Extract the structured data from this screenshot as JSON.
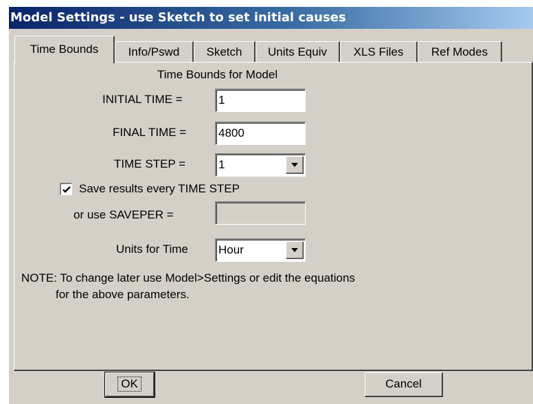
{
  "window": {
    "title": "Model Settings - use Sketch to set initial causes"
  },
  "tabs": [
    {
      "label": "Time Bounds",
      "active": true
    },
    {
      "label": "Info/Pswd",
      "active": false
    },
    {
      "label": "Sketch",
      "active": false
    },
    {
      "label": "Units Equiv",
      "active": false
    },
    {
      "label": "XLS Files",
      "active": false
    },
    {
      "label": "Ref Modes",
      "active": false
    }
  ],
  "time_bounds": {
    "heading": "Time Bounds for Model",
    "initial_time_label": "INITIAL TIME =",
    "initial_time_value": "1",
    "final_time_label": "FINAL TIME =",
    "final_time_value": "4800",
    "time_step_label": "TIME STEP =",
    "time_step_value": "1",
    "save_results_label": "Save results every TIME STEP",
    "save_results_checked": true,
    "saveper_label": "or use SAVEPER =",
    "saveper_value": "",
    "units_label": "Units for Time",
    "units_value": "Hour",
    "note_line1": "NOTE:  To change later use Model>Settings or edit the equations",
    "note_line2": "for the above parameters."
  },
  "buttons": {
    "ok_label": "OK",
    "cancel_label": "Cancel"
  },
  "icons": {
    "dropdown": "chevron-down-icon",
    "check": "check-icon"
  }
}
